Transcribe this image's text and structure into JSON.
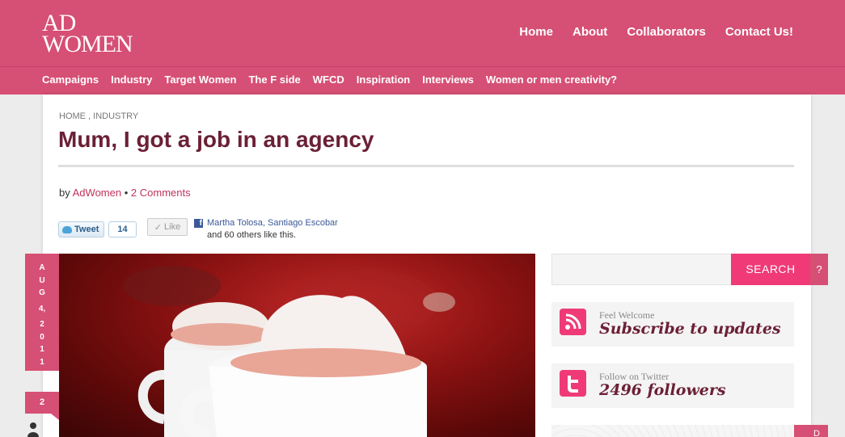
{
  "logo": {
    "line1": "AD",
    "line2": "WOMEN"
  },
  "main_nav": [
    "Home",
    "About",
    "Collaborators",
    "Contact Us!"
  ],
  "categories": [
    "Campaigns",
    "Industry",
    "Target Women",
    "The F side",
    "WFCD",
    "Inspiration",
    "Interviews",
    "Women or men creativity?"
  ],
  "post": {
    "breadcrumb": "HOME , INDUSTRY",
    "title": "Mum, I got a job in an agency",
    "by": "by",
    "author": "AdWomen",
    "separator": "•",
    "comments": "2 Comments",
    "date_letters": [
      "A",
      "U",
      "G",
      "4,",
      "2",
      "0",
      "1",
      "1"
    ],
    "comment_count": "2"
  },
  "social": {
    "tweet_label": "Tweet",
    "tweet_count": "14",
    "like_label": "Like",
    "like_check": "✓",
    "fb_icon": "f",
    "fb_names": "Martha Tolosa, Santiago Escobar",
    "fb_others": "and 60 others like this."
  },
  "sidebar": {
    "search_placeholder": "",
    "search_button": "SEARCH",
    "help_label": "?",
    "subscribe": {
      "small": "Feel Welcome",
      "big": "Subscribe to updates",
      "icon": "rss-icon"
    },
    "twitter": {
      "small": "Follow on Twitter",
      "big": "2496 followers",
      "icon": "twitter-icon"
    },
    "corner_label": "D"
  },
  "colors": {
    "brand": "#d64f74",
    "accent": "#f03a78",
    "title": "#6b2036",
    "link": "#c1335c"
  }
}
